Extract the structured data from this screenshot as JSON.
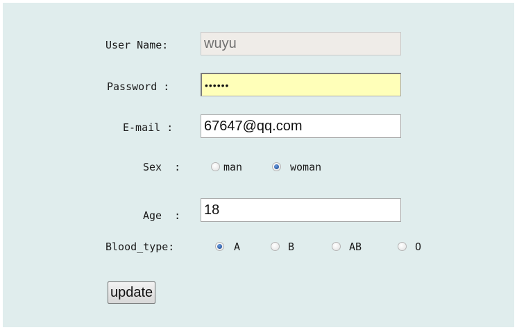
{
  "form": {
    "username_label": "User Name:",
    "username_value": "wuyu",
    "password_label": "Password :",
    "password_masked": "••••••",
    "email_label": "E-mail :",
    "email_value": "67647@qq.com",
    "sex_label": "Sex  :",
    "sex_options": [
      {
        "label": "man",
        "checked": false
      },
      {
        "label": "woman",
        "checked": true
      }
    ],
    "age_label": "Age  :",
    "age_value": "18",
    "blood_label": "Blood_type:",
    "blood_options": [
      {
        "label": "A",
        "checked": true
      },
      {
        "label": "B",
        "checked": false
      },
      {
        "label": "AB",
        "checked": false
      },
      {
        "label": "O",
        "checked": false
      }
    ],
    "update_label": "update"
  },
  "colors": {
    "panel_bg": "#e0eded",
    "focused_field_bg": "#ffffb9",
    "disabled_field_bg": "#efece8"
  }
}
